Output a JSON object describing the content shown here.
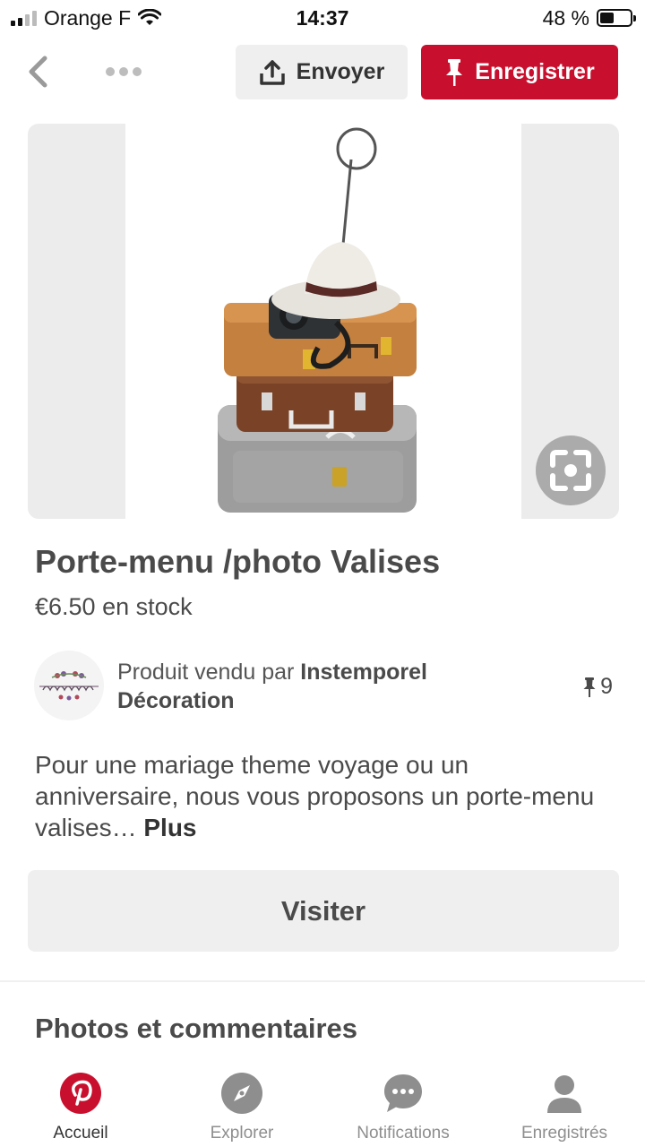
{
  "status_bar": {
    "carrier": "Orange F",
    "time": "14:37",
    "battery": "48 %",
    "battery_level": 0.48
  },
  "toolbar": {
    "send_label": "Envoyer",
    "save_label": "Enregistrer"
  },
  "product": {
    "title": "Porte-menu /photo Valises",
    "price": "€6.50 en stock"
  },
  "seller": {
    "prefix": "Produit vendu par ",
    "name": "Instemporel Décoration",
    "pin_count": "9"
  },
  "description": {
    "text": "Pour  une mariage theme voyage ou un anniversaire,   nous vous proposons un porte-menu valises… ",
    "more": "Plus"
  },
  "visit_label": "Visiter",
  "section_title": "Photos et commentaires",
  "tabs": [
    {
      "label": "Accueil",
      "icon": "pinterest-icon",
      "active": true
    },
    {
      "label": "Explorer",
      "icon": "compass-icon",
      "active": false
    },
    {
      "label": "Notifications",
      "icon": "speech-bubble-icon",
      "active": false
    },
    {
      "label": "Enregistrés",
      "icon": "person-icon",
      "active": false
    }
  ],
  "colors": {
    "brand_red": "#c8102e",
    "button_grey": "#efefef",
    "text_dark": "#4a4a4a"
  }
}
